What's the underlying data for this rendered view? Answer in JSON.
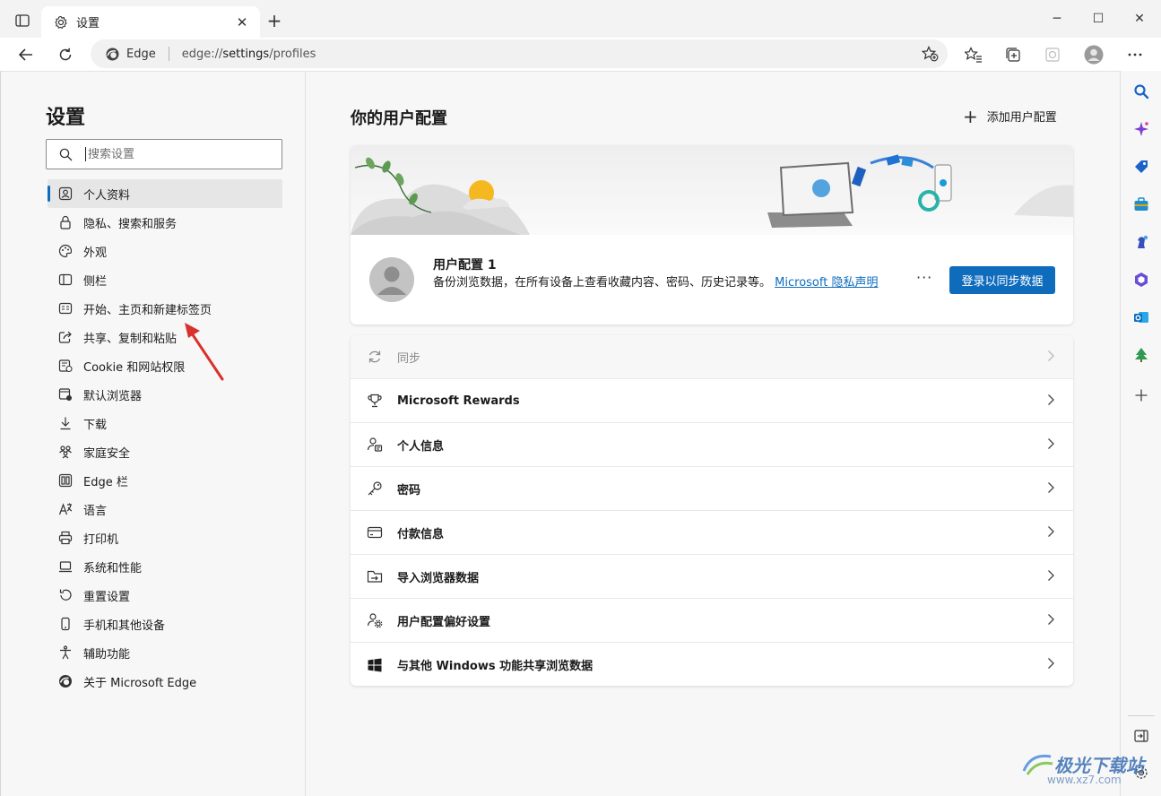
{
  "window": {
    "tab_title": "设置",
    "tab_close": "✕",
    "new_tab": "+",
    "minimize": "─",
    "maximize": "☐",
    "close": "✕"
  },
  "address_bar": {
    "site_label": "Edge",
    "url_prefix": "edge://",
    "url_host": "settings",
    "url_path": "/profiles"
  },
  "nav": {
    "heading": "设置",
    "search_placeholder": "搜索设置",
    "items": [
      {
        "label": "个人资料",
        "icon": "profile-icon",
        "active": true
      },
      {
        "label": "隐私、搜索和服务",
        "icon": "lock-icon"
      },
      {
        "label": "外观",
        "icon": "palette-icon"
      },
      {
        "label": "侧栏",
        "icon": "sidebar-icon"
      },
      {
        "label": "开始、主页和新建标签页",
        "icon": "newtab-icon"
      },
      {
        "label": "共享、复制和粘贴",
        "icon": "share-icon"
      },
      {
        "label": "Cookie 和网站权限",
        "icon": "cookie-icon"
      },
      {
        "label": "默认浏览器",
        "icon": "browser-icon"
      },
      {
        "label": "下载",
        "icon": "download-icon"
      },
      {
        "label": "家庭安全",
        "icon": "family-icon"
      },
      {
        "label": "Edge 栏",
        "icon": "edgebar-icon"
      },
      {
        "label": "语言",
        "icon": "language-icon"
      },
      {
        "label": "打印机",
        "icon": "printer-icon"
      },
      {
        "label": "系统和性能",
        "icon": "laptop-icon"
      },
      {
        "label": "重置设置",
        "icon": "reset-icon"
      },
      {
        "label": "手机和其他设备",
        "icon": "phone-icon"
      },
      {
        "label": "辅助功能",
        "icon": "accessibility-icon"
      },
      {
        "label": "关于 Microsoft Edge",
        "icon": "edge-logo-icon"
      }
    ]
  },
  "main": {
    "title": "你的用户配置",
    "add_profile": "添加用户配置",
    "profile": {
      "name": "用户配置 1",
      "description": "备份浏览数据，在所有设备上查看收藏内容、密码、历史记录等。",
      "privacy_link": "Microsoft 隐私声明",
      "more": "···",
      "sync_button": "登录以同步数据"
    },
    "rows": [
      {
        "label": "同步",
        "icon": "sync-icon",
        "disabled": true
      },
      {
        "label": "Microsoft Rewards",
        "icon": "trophy-icon"
      },
      {
        "label": "个人信息",
        "icon": "personal-info-icon"
      },
      {
        "label": "密码",
        "icon": "key-icon"
      },
      {
        "label": "付款信息",
        "icon": "card-icon"
      },
      {
        "label": "导入浏览器数据",
        "icon": "import-icon"
      },
      {
        "label": "用户配置偏好设置",
        "icon": "profile-prefs-icon"
      },
      {
        "label": "与其他 Windows 功能共享浏览数据",
        "icon": "windows-icon"
      }
    ]
  },
  "watermark": {
    "text": "极光下载站",
    "sub": "www.xz7.com"
  },
  "colors": {
    "accent": "#0f6cbd",
    "arrow": "#d9312b"
  }
}
